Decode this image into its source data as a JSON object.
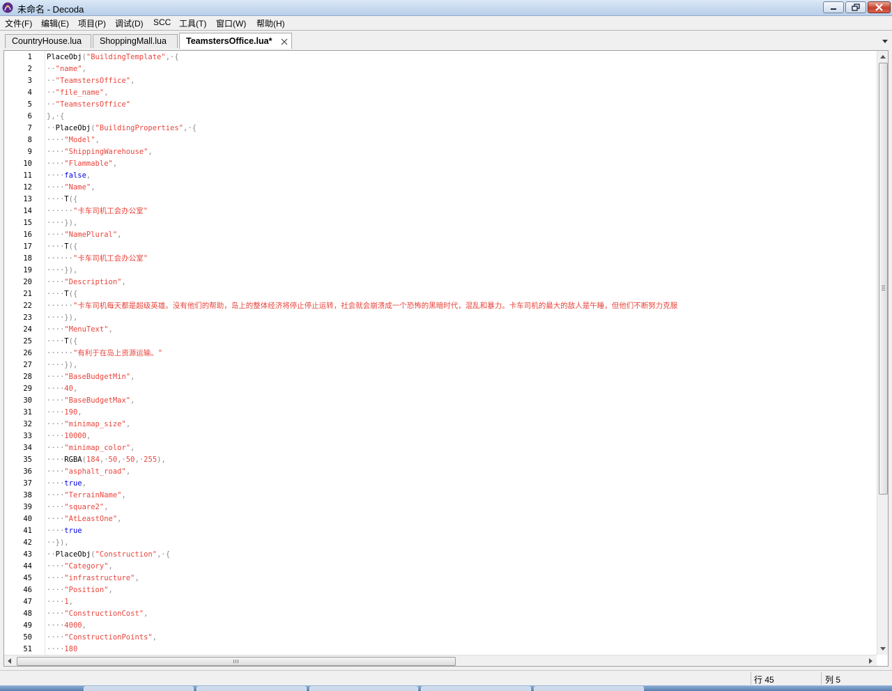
{
  "window": {
    "title": "未命名 - Decoda",
    "accent": "#c5d8ee"
  },
  "menu": [
    {
      "label": "文件(F)"
    },
    {
      "label": "编辑(E)"
    },
    {
      "label": "项目(P)"
    },
    {
      "label": "调试(D)"
    },
    {
      "label": "SCC"
    },
    {
      "label": "工具(T)"
    },
    {
      "label": "窗口(W)"
    },
    {
      "label": "帮助(H)"
    }
  ],
  "tabs": [
    {
      "label": "CountryHouse.lua",
      "active": false
    },
    {
      "label": "ShoppingMall.lua",
      "active": false
    },
    {
      "label": "TeamstersOffice.lua*",
      "active": true
    }
  ],
  "editor": {
    "colors": {
      "string": "#e8453c",
      "keyword": "#0000e6",
      "whitespace": "#8a8a8a",
      "text": "#000000"
    },
    "lines": [
      {
        "n": "1",
        "ind": "",
        "toks": [
          [
            "i",
            "PlaceObj"
          ],
          [
            "p",
            "("
          ],
          [
            "s",
            "\"BuildingTemplate\""
          ],
          [
            "p",
            ",·{"
          ]
        ]
      },
      {
        "n": "2",
        "ind": "··",
        "toks": [
          [
            "s",
            "\"name\""
          ],
          [
            "p",
            ","
          ]
        ]
      },
      {
        "n": "3",
        "ind": "··",
        "toks": [
          [
            "s",
            "\"TeamstersOffice\""
          ],
          [
            "p",
            ","
          ]
        ]
      },
      {
        "n": "4",
        "ind": "··",
        "toks": [
          [
            "s",
            "\"file_name\""
          ],
          [
            "p",
            ","
          ]
        ]
      },
      {
        "n": "5",
        "ind": "··",
        "toks": [
          [
            "s",
            "\"TeamstersOffice\""
          ]
        ]
      },
      {
        "n": "6",
        "ind": "",
        "toks": [
          [
            "p",
            "},·{"
          ]
        ]
      },
      {
        "n": "7",
        "ind": "··",
        "toks": [
          [
            "i",
            "PlaceObj"
          ],
          [
            "p",
            "("
          ],
          [
            "s",
            "\"BuildingProperties\""
          ],
          [
            "p",
            ",·{"
          ]
        ]
      },
      {
        "n": "8",
        "ind": "····",
        "toks": [
          [
            "s",
            "\"Model\""
          ],
          [
            "p",
            ","
          ]
        ]
      },
      {
        "n": "9",
        "ind": "····",
        "toks": [
          [
            "s",
            "\"ShippingWarehouse\""
          ],
          [
            "p",
            ","
          ]
        ]
      },
      {
        "n": "10",
        "ind": "····",
        "toks": [
          [
            "s",
            "\"Flammable\""
          ],
          [
            "p",
            ","
          ]
        ]
      },
      {
        "n": "11",
        "ind": "····",
        "toks": [
          [
            "k",
            "false"
          ],
          [
            "p",
            ","
          ]
        ]
      },
      {
        "n": "12",
        "ind": "····",
        "toks": [
          [
            "s",
            "\"Name\""
          ],
          [
            "p",
            ","
          ]
        ]
      },
      {
        "n": "13",
        "ind": "····",
        "toks": [
          [
            "i",
            "T"
          ],
          [
            "p",
            "({"
          ]
        ]
      },
      {
        "n": "14",
        "ind": "······",
        "toks": [
          [
            "s",
            "\"卡车司机工会办公室\""
          ]
        ]
      },
      {
        "n": "15",
        "ind": "····",
        "toks": [
          [
            "p",
            "}),"
          ]
        ]
      },
      {
        "n": "16",
        "ind": "····",
        "toks": [
          [
            "s",
            "\"NamePlural\""
          ],
          [
            "p",
            ","
          ]
        ]
      },
      {
        "n": "17",
        "ind": "····",
        "toks": [
          [
            "i",
            "T"
          ],
          [
            "p",
            "({"
          ]
        ]
      },
      {
        "n": "18",
        "ind": "······",
        "toks": [
          [
            "s",
            "\"卡车司机工会办公室\""
          ]
        ]
      },
      {
        "n": "19",
        "ind": "····",
        "toks": [
          [
            "p",
            "}),"
          ]
        ]
      },
      {
        "n": "20",
        "ind": "····",
        "toks": [
          [
            "s",
            "\"Description\""
          ],
          [
            "p",
            ","
          ]
        ]
      },
      {
        "n": "21",
        "ind": "····",
        "toks": [
          [
            "i",
            "T"
          ],
          [
            "p",
            "({"
          ]
        ]
      },
      {
        "n": "22",
        "ind": "······",
        "toks": [
          [
            "s",
            "\"卡车司机每天都是超级英雄。没有他们的帮助，岛上的整体经济将停止停止运转，社会就会崩溃成一个恐怖的黑暗时代，混乱和暴力。卡车司机的最大的敌人是午睡，但他们不断努力克服"
          ]
        ]
      },
      {
        "n": "23",
        "ind": "····",
        "toks": [
          [
            "p",
            "}),"
          ]
        ]
      },
      {
        "n": "24",
        "ind": "····",
        "toks": [
          [
            "s",
            "\"MenuText\""
          ],
          [
            "p",
            ","
          ]
        ]
      },
      {
        "n": "25",
        "ind": "····",
        "toks": [
          [
            "i",
            "T"
          ],
          [
            "p",
            "({"
          ]
        ]
      },
      {
        "n": "26",
        "ind": "······",
        "toks": [
          [
            "s",
            "\"有利于在岛上资源运输。\""
          ]
        ]
      },
      {
        "n": "27",
        "ind": "····",
        "toks": [
          [
            "p",
            "}),"
          ]
        ]
      },
      {
        "n": "28",
        "ind": "····",
        "toks": [
          [
            "s",
            "\"BaseBudgetMin\""
          ],
          [
            "p",
            ","
          ]
        ]
      },
      {
        "n": "29",
        "ind": "····",
        "toks": [
          [
            "n",
            "40"
          ],
          [
            "p",
            ","
          ]
        ]
      },
      {
        "n": "30",
        "ind": "····",
        "toks": [
          [
            "s",
            "\"BaseBudgetMax\""
          ],
          [
            "p",
            ","
          ]
        ]
      },
      {
        "n": "31",
        "ind": "····",
        "toks": [
          [
            "n",
            "190"
          ],
          [
            "p",
            ","
          ]
        ]
      },
      {
        "n": "32",
        "ind": "····",
        "toks": [
          [
            "s",
            "\"minimap_size\""
          ],
          [
            "p",
            ","
          ]
        ]
      },
      {
        "n": "33",
        "ind": "····",
        "toks": [
          [
            "n",
            "10000"
          ],
          [
            "p",
            ","
          ]
        ]
      },
      {
        "n": "34",
        "ind": "····",
        "toks": [
          [
            "s",
            "\"minimap_color\""
          ],
          [
            "p",
            ","
          ]
        ]
      },
      {
        "n": "35",
        "ind": "····",
        "toks": [
          [
            "i",
            "RGBA"
          ],
          [
            "p",
            "("
          ],
          [
            "n",
            "184"
          ],
          [
            "p",
            ",·"
          ],
          [
            "n",
            "50"
          ],
          [
            "p",
            ",·"
          ],
          [
            "n",
            "50"
          ],
          [
            "p",
            ",·"
          ],
          [
            "n",
            "255"
          ],
          [
            "p",
            "),"
          ]
        ]
      },
      {
        "n": "36",
        "ind": "····",
        "toks": [
          [
            "s",
            "\"asphalt_road\""
          ],
          [
            "p",
            ","
          ]
        ]
      },
      {
        "n": "37",
        "ind": "····",
        "toks": [
          [
            "k",
            "true"
          ],
          [
            "p",
            ","
          ]
        ]
      },
      {
        "n": "38",
        "ind": "····",
        "toks": [
          [
            "s",
            "\"TerrainName\""
          ],
          [
            "p",
            ","
          ]
        ]
      },
      {
        "n": "39",
        "ind": "····",
        "toks": [
          [
            "s",
            "\"square2\""
          ],
          [
            "p",
            ","
          ]
        ]
      },
      {
        "n": "40",
        "ind": "····",
        "toks": [
          [
            "s",
            "\"AtLeastOne\""
          ],
          [
            "p",
            ","
          ]
        ]
      },
      {
        "n": "41",
        "ind": "····",
        "toks": [
          [
            "k",
            "true"
          ]
        ]
      },
      {
        "n": "42",
        "ind": "··",
        "toks": [
          [
            "p",
            "}),"
          ]
        ]
      },
      {
        "n": "43",
        "ind": "··",
        "toks": [
          [
            "i",
            "PlaceObj"
          ],
          [
            "p",
            "("
          ],
          [
            "s",
            "\"Construction\""
          ],
          [
            "p",
            ",·{"
          ]
        ]
      },
      {
        "n": "44",
        "ind": "····",
        "toks": [
          [
            "s",
            "\"Category\""
          ],
          [
            "p",
            ","
          ]
        ]
      },
      {
        "n": "45",
        "ind": "····",
        "toks": [
          [
            "s",
            "\"infrastructure\""
          ],
          [
            "p",
            ","
          ]
        ]
      },
      {
        "n": "46",
        "ind": "····",
        "toks": [
          [
            "s",
            "\"Position\""
          ],
          [
            "p",
            ","
          ]
        ]
      },
      {
        "n": "47",
        "ind": "····",
        "toks": [
          [
            "n",
            "1"
          ],
          [
            "p",
            ","
          ]
        ]
      },
      {
        "n": "48",
        "ind": "····",
        "toks": [
          [
            "s",
            "\"ConstructionCost\""
          ],
          [
            "p",
            ","
          ]
        ]
      },
      {
        "n": "49",
        "ind": "····",
        "toks": [
          [
            "n",
            "4000"
          ],
          [
            "p",
            ","
          ]
        ]
      },
      {
        "n": "50",
        "ind": "····",
        "toks": [
          [
            "s",
            "\"ConstructionPoints\""
          ],
          [
            "p",
            ","
          ]
        ]
      },
      {
        "n": "51",
        "ind": "····",
        "toks": [
          [
            "n",
            "180"
          ]
        ]
      }
    ]
  },
  "statusbar": {
    "line": "行 45",
    "col": "列 5"
  }
}
